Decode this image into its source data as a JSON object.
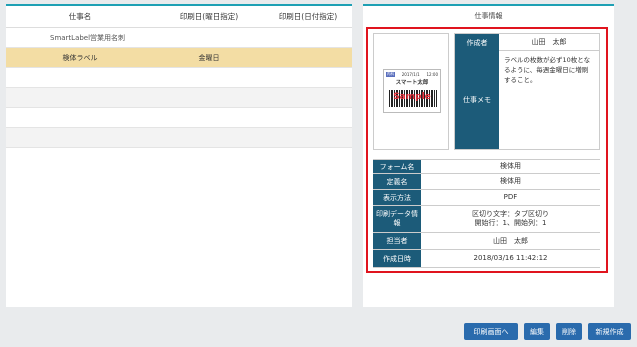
{
  "list": {
    "headers": [
      "仕事名",
      "印刷日(曜日指定)",
      "印刷日(日付指定)"
    ],
    "group_label": "SmartLabel営業用名刺",
    "selected_row": {
      "name": "検体ラベル",
      "weekday": "金曜日",
      "date": ""
    }
  },
  "detail": {
    "title": "仕事情報",
    "author_label": "作成者",
    "author": "山田　太郎",
    "memo_label": "仕事メモ",
    "memo": "ラベルの枚数が必ず10枚となるように、毎週金曜日に増刷すること。",
    "preview": {
      "badge": "内科",
      "date": "2017/1/1",
      "time": "12:00",
      "name": "スマート太郎",
      "watermark": "Sample"
    },
    "rows": [
      {
        "label": "フォーム名",
        "value": [
          "検体用"
        ]
      },
      {
        "label": "定義名",
        "value": [
          "検体用"
        ]
      },
      {
        "label": "表示方法",
        "value": [
          "PDF"
        ]
      },
      {
        "label": "印刷データ情報",
        "value": [
          "区切り文字：タブ区切り",
          "開始行：1、開始列：1"
        ]
      },
      {
        "label": "担当者",
        "value": [
          "山田　太郎"
        ]
      },
      {
        "label": "作成日時",
        "value": [
          "2018/03/16 11:42:12"
        ]
      }
    ]
  },
  "buttons": {
    "print_screen": "印刷画面へ",
    "edit": "編集",
    "delete": "削除",
    "new": "新規作成"
  }
}
